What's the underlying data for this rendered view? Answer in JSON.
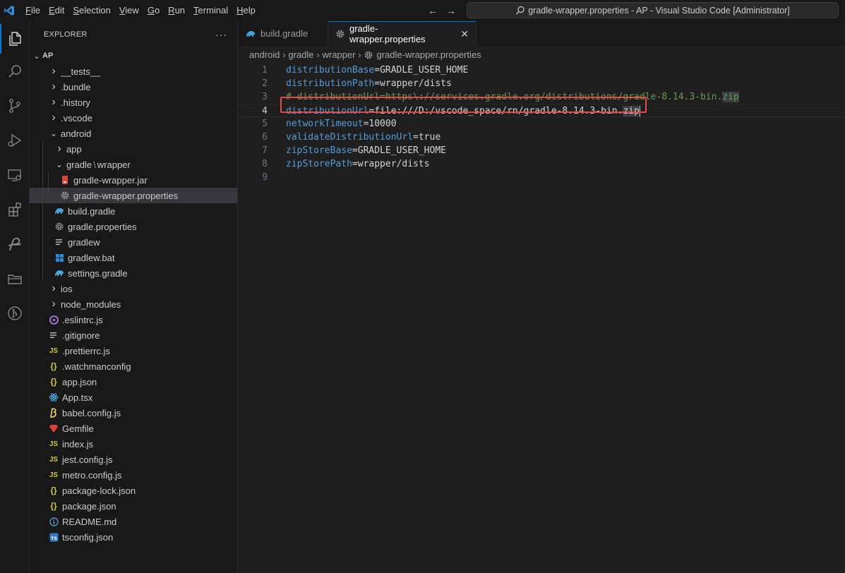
{
  "window": {
    "title": "gradle-wrapper.properties - AP - Visual Studio Code [Administrator]",
    "menu": [
      {
        "label": "File",
        "u": "F",
        "rest": "ile"
      },
      {
        "label": "Edit",
        "u": "E",
        "rest": "dit"
      },
      {
        "label": "Selection",
        "u": "S",
        "rest": "election"
      },
      {
        "label": "View",
        "u": "V",
        "rest": "iew"
      },
      {
        "label": "Go",
        "u": "G",
        "rest": "o"
      },
      {
        "label": "Run",
        "u": "R",
        "rest": "un"
      },
      {
        "label": "Terminal",
        "u": "T",
        "rest": "erminal"
      },
      {
        "label": "Help",
        "u": "H",
        "rest": "elp"
      }
    ],
    "back_arrow": "←",
    "forward_arrow": "→"
  },
  "colors": {
    "accent": "#0078d4",
    "highlight_box": "#e84a4a",
    "key": "#569cd6",
    "comment": "#6a9955"
  },
  "sidebar": {
    "title": "EXPLORER",
    "more": "···",
    "root": "AP",
    "items": [
      {
        "label": "__tests__",
        "type": "folder",
        "chevron": "›",
        "depth": 1
      },
      {
        "label": ".bundle",
        "type": "folder",
        "chevron": "›",
        "depth": 1
      },
      {
        "label": ".history",
        "type": "folder",
        "chevron": "›",
        "depth": 1
      },
      {
        "label": ".vscode",
        "type": "folder",
        "chevron": "›",
        "depth": 1
      },
      {
        "label": "android",
        "type": "folder-open",
        "chevron": "⌄",
        "depth": 1
      },
      {
        "label": "app",
        "type": "folder",
        "chevron": "›",
        "depth": 2
      },
      {
        "label": "gradle",
        "label2": "wrapper",
        "type": "folder-open",
        "chevron": "⌄",
        "depth": 2
      },
      {
        "label": "gradle-wrapper.jar",
        "type": "jar",
        "depth": 3
      },
      {
        "label": "gradle-wrapper.properties",
        "type": "gear",
        "depth": 3,
        "selected": true
      },
      {
        "label": "build.gradle",
        "type": "gradle",
        "depth": 2
      },
      {
        "label": "gradle.properties",
        "type": "gear",
        "depth": 2
      },
      {
        "label": "gradlew",
        "type": "lines",
        "depth": 2
      },
      {
        "label": "gradlew.bat",
        "type": "windows",
        "depth": 2
      },
      {
        "label": "settings.gradle",
        "type": "gradle",
        "depth": 2
      },
      {
        "label": "ios",
        "type": "folder",
        "chevron": "›",
        "depth": 1
      },
      {
        "label": "node_modules",
        "type": "folder",
        "chevron": "›",
        "depth": 1
      },
      {
        "label": ".eslintrc.js",
        "type": "eslint",
        "depth": 1
      },
      {
        "label": ".gitignore",
        "type": "lines",
        "depth": 1
      },
      {
        "label": ".prettierrc.js",
        "type": "js",
        "icon_text": "JS",
        "depth": 1
      },
      {
        "label": ".watchmanconfig",
        "type": "json",
        "icon_text": "{}",
        "depth": 1
      },
      {
        "label": "app.json",
        "type": "json",
        "icon_text": "{}",
        "depth": 1
      },
      {
        "label": "App.tsx",
        "type": "react",
        "depth": 1
      },
      {
        "label": "babel.config.js",
        "type": "babel",
        "depth": 1
      },
      {
        "label": "Gemfile",
        "type": "ruby",
        "depth": 1
      },
      {
        "label": "index.js",
        "type": "js",
        "icon_text": "JS",
        "depth": 1
      },
      {
        "label": "jest.config.js",
        "type": "js",
        "icon_text": "JS",
        "depth": 1
      },
      {
        "label": "metro.config.js",
        "type": "js",
        "icon_text": "JS",
        "depth": 1
      },
      {
        "label": "package-lock.json",
        "type": "json",
        "icon_text": "{}",
        "depth": 1
      },
      {
        "label": "package.json",
        "type": "json",
        "icon_text": "{}",
        "depth": 1
      },
      {
        "label": "README.md",
        "type": "info",
        "depth": 1
      },
      {
        "label": "tsconfig.json",
        "type": "ts",
        "icon_text": "TS",
        "depth": 1
      }
    ]
  },
  "tabs": [
    {
      "label": "build.gradle",
      "active": false,
      "icon": "gradle-icon"
    },
    {
      "label": "gradle-wrapper.properties",
      "active": true,
      "icon": "gear-icon",
      "close": "✕"
    }
  ],
  "breadcrumb": [
    "android",
    "gradle",
    "wrapper",
    "gradle-wrapper.properties"
  ],
  "code": {
    "lines": [
      {
        "num": "1",
        "key": "distributionBase",
        "eq": "=",
        "val": "GRADLE_USER_HOME"
      },
      {
        "num": "2",
        "key": "distributionPath",
        "eq": "=",
        "val": "wrapper/dists"
      },
      {
        "num": "3",
        "comment": "# distributionUrl=https\\://services.gradle.org/distributions/gradle-8.14.3-bin.",
        "comment_hl": "zip"
      },
      {
        "num": "4",
        "key": "distributionUrl",
        "eq": "=",
        "val": "file:///D:/vscode_space/rn/gradle-8.14.3-bin.",
        "val_hl": "zip",
        "current": true
      },
      {
        "num": "5",
        "key": "networkTimeout",
        "eq": "=",
        "val": "10000"
      },
      {
        "num": "6",
        "key": "validateDistributionUrl",
        "eq": "=",
        "val": "true"
      },
      {
        "num": "7",
        "key": "zipStoreBase",
        "eq": "=",
        "val": "GRADLE_USER_HOME"
      },
      {
        "num": "8",
        "key": "zipStorePath",
        "eq": "=",
        "val": "wrapper/dists"
      },
      {
        "num": "9"
      }
    ]
  }
}
